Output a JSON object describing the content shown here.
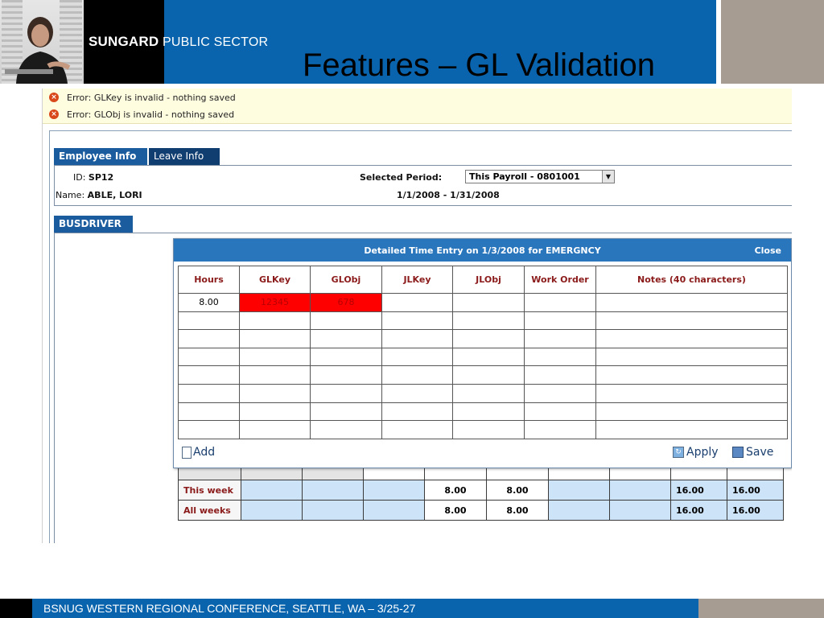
{
  "slide": {
    "brand_bold": "SUNGARD",
    "brand_light": "PUBLIC SECTOR",
    "title": "Features – GL Validation",
    "footer": "BSNUG WESTERN REGIONAL CONFERENCE, SEATTLE, WA – 3/25-27"
  },
  "errors": [
    "Error: GLKey is invalid - nothing saved",
    "Error: GLObj is invalid - nothing saved"
  ],
  "tabs": {
    "employee_info": "Employee Info",
    "leave_info": "Leave Info",
    "busdriver": "BUSDRIVER"
  },
  "employee": {
    "id_label": "ID:",
    "id_value": "SP12",
    "name_label": "Name:",
    "name_value": "ABLE, LORI",
    "period_label": "Selected Period:",
    "period_value": "This Payroll - 0801001",
    "date_range": "1/1/2008 - 1/31/2008"
  },
  "popup": {
    "title": "Detailed Time Entry on 1/3/2008 for EMERGNCY",
    "close": "Close",
    "columns": [
      "Hours",
      "GLKey",
      "GLObj",
      "JLKey",
      "JLObj",
      "Work Order",
      "Notes (40 characters)"
    ],
    "first_row": {
      "hours": "8.00",
      "glkey": "12345",
      "globj": "678"
    },
    "error_color": "#ff0000",
    "add_label": "Add",
    "apply_label": "Apply",
    "save_label": "Save"
  },
  "summary": {
    "this_week": {
      "label": "This week",
      "v1": "8.00",
      "v2": "8.00",
      "t1": "16.00",
      "t2": "16.00"
    },
    "all_weeks": {
      "label": "All weeks",
      "v1": "8.00",
      "v2": "8.00",
      "t1": "16.00",
      "t2": "16.00"
    }
  },
  "colors": {
    "header_blue": "#0a64ad",
    "header_grey": "#a69c91",
    "popup_bar": "#2a76bd",
    "error_bg": "#fffde0"
  }
}
